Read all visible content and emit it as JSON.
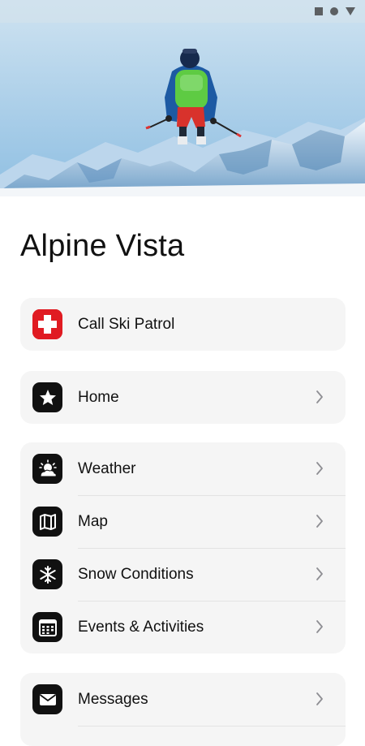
{
  "status_bar": {
    "icons": [
      "stop-square-icon",
      "circle-icon",
      "triangle-down-icon"
    ]
  },
  "hero": {
    "image": "skier-jumping-over-snowy-mountains"
  },
  "app": {
    "title": "Alpine Vista"
  },
  "emergency": {
    "label": "Call Ski Patrol",
    "icon": "medical-cross-icon",
    "accent": "#e01b22"
  },
  "menu": {
    "home": {
      "label": "Home",
      "icon": "star-icon"
    },
    "weather": {
      "label": "Weather",
      "icon": "weather-sun-cloud-icon"
    },
    "map": {
      "label": "Map",
      "icon": "map-icon"
    },
    "snow": {
      "label": "Snow Conditions",
      "icon": "snowflake-icon"
    },
    "events": {
      "label": "Events & Activities",
      "icon": "calendar-icon"
    },
    "messages": {
      "label": "Messages",
      "icon": "envelope-icon"
    }
  },
  "colors": {
    "card_bg": "#f5f5f5",
    "icon_bg": "#111111",
    "text": "#111111",
    "chevron": "#8e8e93"
  }
}
